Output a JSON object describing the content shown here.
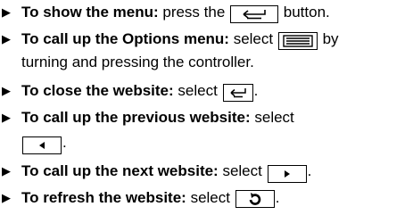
{
  "instructions": [
    {
      "bullet_icon": "triangle-right",
      "lead": "To show the menu:",
      "text_before": "press the",
      "button_icon": "back-icon",
      "text_after": "button."
    },
    {
      "bullet_icon": "triangle-right",
      "lead": "To call up the Options menu:",
      "text_before": "select",
      "button_icon": "menu-lines-icon",
      "text_after": "by",
      "continuation": "turning and pressing the controller."
    },
    {
      "bullet_icon": "triangle-right",
      "lead": "To close the website:",
      "text_before": "select",
      "button_icon": "back-icon",
      "text_after": "."
    },
    {
      "bullet_icon": "triangle-right",
      "lead": "To call up the previous website:",
      "text_before": "select",
      "button_icon": "left-arrow-icon",
      "text_after": "."
    },
    {
      "bullet_icon": "triangle-right",
      "lead": "To call up the next website:",
      "text_before": "select",
      "button_icon": "right-arrow-icon",
      "text_after": "."
    },
    {
      "bullet_icon": "triangle-right",
      "lead": "To refresh the website:",
      "text_before": "select",
      "button_icon": "refresh-icon",
      "text_after": "."
    }
  ]
}
